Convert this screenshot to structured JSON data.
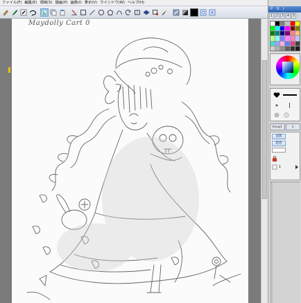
{
  "menubar": {
    "items": [
      "ファイル(F)",
      "編集(E)",
      "領域(S)",
      "描画(P)",
      "画像(I)",
      "表示(V)",
      "ウインドウ(W)",
      "ヘルプ(H)"
    ]
  },
  "toolbar": {
    "tools": [
      "pen-tool",
      "brush-tool",
      "fill-tool",
      "lasso-tool",
      "select-tool",
      "copy-tool",
      "paste-tool",
      "line-tool",
      "rect-tool",
      "slash-tool",
      "ellipse-tool",
      "polygon-tool",
      "curve-tool",
      "rotate-tool",
      "flip-tool",
      "transform-tool",
      "zoom-tool",
      "magic-wand-tool",
      "color-swatch",
      "view-tool",
      "view-tool-2"
    ],
    "active_tool": "select-tool",
    "current_color": "#000000"
  },
  "canvas": {
    "title": "Maydolly Cart 0"
  },
  "right_panel": {
    "header": "P O I",
    "tabs": [
      "1",
      "2",
      "3",
      "4",
      "5"
    ],
    "palette_colors": [
      "#ffffff",
      "#000000",
      "#7f7f7f",
      "#c0c0c0",
      "#ff0000",
      "#ffff00",
      "#00ff00",
      "#00ffff",
      "#0000ff",
      "#ff00ff",
      "#800000",
      "#808000",
      "#008000",
      "#008080",
      "#000080",
      "#800080",
      "#ff8080",
      "#ffc080",
      "#c0ff80",
      "#80ffff",
      "#8080ff",
      "#ff80ff",
      "#ff80c0",
      "#c0c0ff",
      "#40e0d0",
      "#a0a0ff",
      "#ffb0e0",
      "#6080ff",
      "#e04080",
      "#404040",
      "#d0d0d0",
      "#b0b0b0",
      "#909090",
      "#606060",
      "#303030",
      "#1a1a1a"
    ],
    "layer_tabs": [
      "Group1",
      "2"
    ],
    "layer_buttons": [
      "追加",
      "結合"
    ],
    "layer_items": [
      "1"
    ]
  }
}
